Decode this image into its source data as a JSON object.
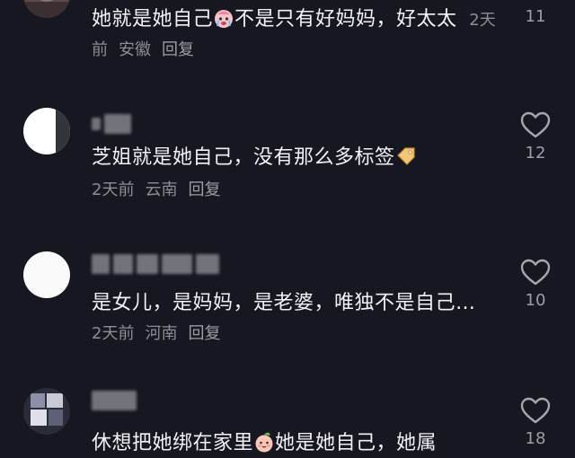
{
  "comments": [
    {
      "text_before": "她就是她自己",
      "text_after": "不是只有好妈妈，好太太",
      "emoji": "crying-face-emoji",
      "time": "2天前",
      "location": "安徽",
      "reply": "回复",
      "likes": "11"
    },
    {
      "text_before": "芝姐就是她自己，没有那么多标签",
      "emoji": "tag-emoji",
      "time": "2天前",
      "location": "云南",
      "reply": "回复",
      "likes": "12"
    },
    {
      "text_before": "是女儿，是妈妈，是老婆，唯独不是自己…",
      "time": "2天前",
      "location": "河南",
      "reply": "回复",
      "likes": "10"
    },
    {
      "text_before": "休想把她绑在家里",
      "text_after": "她是她自己，她属",
      "emoji": "peach-face-emoji",
      "likes": "18"
    }
  ],
  "icons": {
    "like": "heart-outline-icon"
  },
  "colors": {
    "background": "#161720",
    "text": "#f2f2f5",
    "meta": "#8c8d95"
  }
}
